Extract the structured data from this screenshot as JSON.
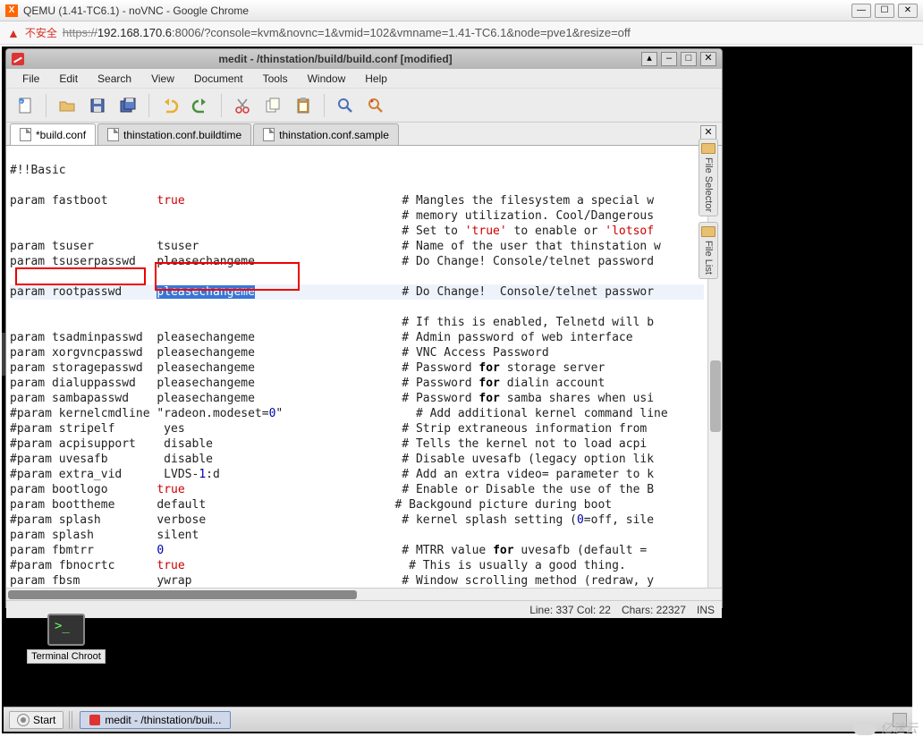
{
  "chrome": {
    "title": "QEMU (1.41-TC6.1) - noVNC - Google Chrome",
    "insecure_label": "不安全",
    "url_scheme": "https://",
    "url_host": "192.168.170.6",
    "url_rest": ":8006/?console=kvm&novnc=1&vmid=102&vmname=1.41-TC6.1&node=pve1&resize=off",
    "btn_min": "—",
    "btn_max": "☐",
    "btn_close": "✕"
  },
  "medit": {
    "title": "medit - /thinstation/build/build.conf [modified]",
    "menus": [
      "File",
      "Edit",
      "Search",
      "View",
      "Document",
      "Tools",
      "Window",
      "Help"
    ],
    "toolbar_icons": [
      "new-file",
      "open-file",
      "save-file",
      "save-all",
      "undo",
      "redo",
      "cut",
      "copy",
      "paste",
      "find",
      "find-replace"
    ],
    "tabs": [
      {
        "label": "*build.conf",
        "active": true
      },
      {
        "label": "thinstation.conf.buildtime",
        "active": false
      },
      {
        "label": "thinstation.conf.sample",
        "active": false
      }
    ],
    "tabclose": "✕",
    "statusbar": {
      "pos": "Line: 337 Col: 22",
      "chars": "Chars: 22327",
      "mode": "INS"
    },
    "side": {
      "file_selector": "File Selector",
      "file_list": "File List"
    },
    "code": {
      "l1": "#!!Basic",
      "l2": "",
      "l3a": "param fastboot       ",
      "l3b": "true",
      "l3c": "                               # Mangles the ",
      "l3d": "f",
      "l3e": "ilesystem a special w",
      "l4": "                                                        # memory utilization. Cool/Dangerous",
      "l5a": "                                                        # Set to ",
      "l5b": "'true'",
      "l5c": " to enable or ",
      "l5d": "'lotsof",
      "l6": "param tsuser         tsuser                             # Name of the user that thinstation w",
      "l7": "param tsuserpasswd   pleasechangeme                     # Do Change! Console/telnet password",
      "l8": "",
      "l9a": "param rootpasswd     ",
      "l9b": "pleasechangeme",
      "l9c": "                     # Do Change!  Console/telnet passwor",
      "l10": "                                                        # If this is enabled, Telnetd will b",
      "l11": "param tsadminpasswd  pleasechangeme                     # Admin password of web interface",
      "l12": "param xorgvncpasswd  pleasechangeme                     # VNC Access Password",
      "l13a": "param storagepasswd  pleasechangeme                     # Password ",
      "l13b": "for",
      "l13c": " storage server",
      "l14a": "param dialuppasswd   pleasechangeme                     # Password ",
      "l14b": "for",
      "l14c": " dialin account",
      "l15a": "param sambapasswd    pleasechangeme                     # Password ",
      "l15b": "for",
      "l15c": " samba shares when usi",
      "l16a": "#param kernelcmdline \"radeon.modeset=",
      "l16b": "0",
      "l16c": "\"                   # Add additional kernel command line",
      "l17": "#param stripelf       yes                               # Strip extraneous information from ",
      "l18": "#param acpisupport    disable                           # Tells the kernel not to load acpi",
      "l19": "#param uvesafb        disable                           # Disable uvesafb (legacy option lik",
      "l20a": "#param extra_vid      LVDS-",
      "l20b": "1",
      "l20c": ":d                          # Add an extra video= parameter to k",
      "l21a": "param bootlogo       ",
      "l21b": "true",
      "l21c": "                               # Enable or Disable the use of the B",
      "l22": "param boottheme      default                           # Backgound picture during boot",
      "l23a": "#param splash        verbose                            # kernel splash setting (",
      "l23b": "0",
      "l23c": "=off, sile",
      "l24": "param splash         silent",
      "l25a": "param fbmtrr         ",
      "l25b": "0",
      "l25c": "                                  # MTRR value ",
      "l25d": "for",
      "l25e": " uvesafb (default = ",
      "l26a": "#param fbnocrtc      ",
      "l26b": "true",
      "l26c": "                                # This is usually a good thing.",
      "l27": "param fbsm           ywrap                              # Window scrolling method (redraw, y"
    }
  },
  "desktop": {
    "icon_label": "Terminal Chroot"
  },
  "taskbar": {
    "start": "Start",
    "task1": "medit - /thinstation/buil..."
  },
  "watermark": "亿速云"
}
